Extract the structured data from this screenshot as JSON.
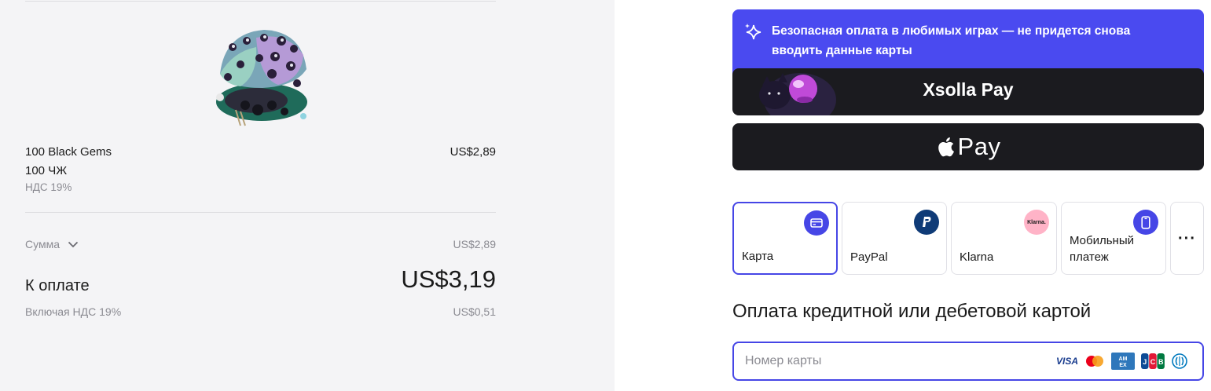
{
  "summary": {
    "item_name": "100 Black Gems",
    "item_price": "US$2,89",
    "item_subtitle": "100 ЧЖ",
    "item_vat": "НДС 19%",
    "sum_label": "Сумма",
    "sum_value": "US$2,89",
    "pay_label": "К оплате",
    "pay_value": "US$3,19",
    "incl_label": "Включая НДС 19%",
    "incl_value": "US$0,51"
  },
  "banner": {
    "text": "Безопасная оплата в любимых играх — не придется снова вводить данные карты",
    "icon": "sparkle-icon"
  },
  "xsolla_pay": {
    "label": "Xsolla Pay"
  },
  "apple_pay": {
    "label": "Pay",
    "icon": "apple-icon"
  },
  "methods": [
    {
      "label": "Карта",
      "icon": "card-icon",
      "selected": true
    },
    {
      "label": "PayPal",
      "icon": "paypal-icon"
    },
    {
      "label": "Klarna",
      "icon": "klarna-icon",
      "icon_text": "Klarna."
    },
    {
      "label": "Мобильный платеж",
      "icon": "mobile-icon"
    },
    {
      "label": "···",
      "icon": "more-icon"
    }
  ],
  "card_form": {
    "title": "Оплата кредитной или дебетовой картой",
    "number_placeholder": "Номер карты",
    "brands": [
      "VISA",
      "Mastercard",
      "AMEX",
      "JCB",
      "Diners Club"
    ]
  },
  "colors": {
    "accent": "#4646e6",
    "banner": "#4a4af0",
    "dark_button": "#1b1b1f",
    "panel_bg": "#f4f4f6",
    "muted_text": "#8b8b92"
  }
}
